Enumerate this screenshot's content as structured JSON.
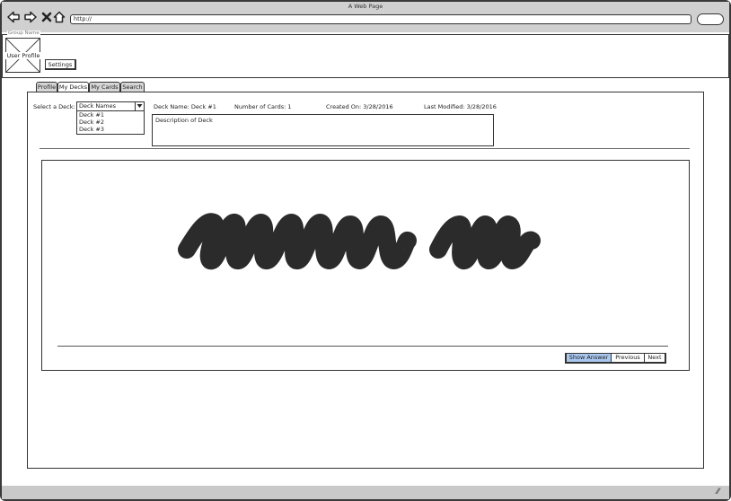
{
  "window": {
    "title": "A Web Page"
  },
  "browser": {
    "url": "http://"
  },
  "header": {
    "group_name": "Group Name",
    "profile_label": "User Profile",
    "settings_label": "Settings"
  },
  "tabs": [
    "Profile",
    "My Decks",
    "My Cards",
    "Search"
  ],
  "deck": {
    "select_label": "Select a Deck:",
    "select_value": "Deck Names",
    "options": [
      "Deck #1",
      "Deck #2",
      "Deck #3"
    ],
    "name": "Deck Name: Deck #1",
    "card_count": "Number of Cards: 1",
    "created": "Created On: 3/28/2016",
    "modified": "Last Modified: 3/28/2016",
    "description": "Description of Deck"
  },
  "card_controls": {
    "show_answer": "Show Answer",
    "previous": "Previous",
    "next": "Next"
  },
  "colors": {
    "chrome": "#d0d0d0",
    "accent": "#a9c7ef",
    "scribble": "#2b2b2b"
  }
}
